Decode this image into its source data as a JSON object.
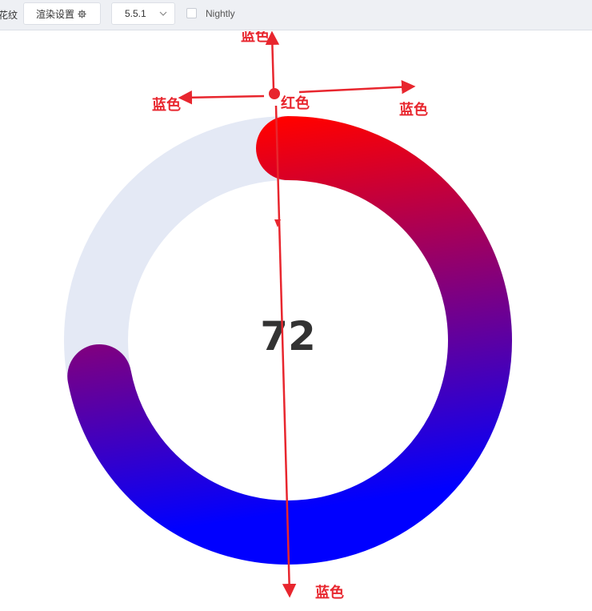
{
  "toolbar": {
    "left_fragment": "花纹",
    "render_settings_label": "渲染设置",
    "version_value": "5.5.1",
    "nightly_label": "Nightly"
  },
  "gauge": {
    "value": "72",
    "progress_fraction": 0.72,
    "gradient_start_color": "#ff0000",
    "gradient_end_color": "#0000ff",
    "track_color": "#e4e9f5",
    "value_color": "#333333"
  },
  "annotations": {
    "top": "蓝色",
    "left": "蓝色",
    "center": "红色",
    "right": "蓝色",
    "bottom": "蓝色",
    "color": "#e8262e"
  }
}
